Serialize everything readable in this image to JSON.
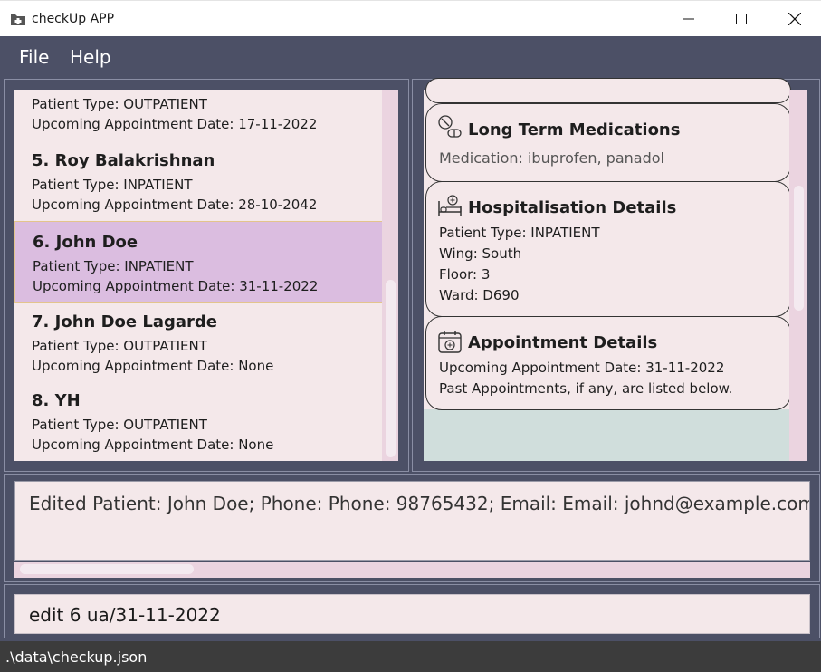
{
  "window": {
    "title": "checkUp APP",
    "icon": "medical-folder-icon"
  },
  "menu": [
    {
      "label": "File"
    },
    {
      "label": "Help"
    }
  ],
  "patient_list": [
    {
      "name": null,
      "type": "Patient Type: OUTPATIENT",
      "appt": "Upcoming Appointment Date: 17-11-2022"
    },
    {
      "name": "5.  Roy Balakrishnan",
      "type": "Patient Type: INPATIENT",
      "appt": "Upcoming Appointment Date: 28-10-2042"
    },
    {
      "name": "6.  John Doe",
      "type": "Patient Type: INPATIENT",
      "appt": "Upcoming Appointment Date: 31-11-2022",
      "selected": true
    },
    {
      "name": "7.  John Doe   Lagarde",
      "type": "Patient Type: OUTPATIENT",
      "appt": "Upcoming Appointment Date: None"
    },
    {
      "name": "8.  YH",
      "type": "Patient Type: OUTPATIENT",
      "appt": "Upcoming Appointment Date: None"
    }
  ],
  "details": {
    "medications": {
      "title": "Long Term Medications",
      "icon": "pill-icon",
      "line": "Medication: ibuprofen, panadol"
    },
    "hospitalisation": {
      "title": "Hospitalisation Details",
      "icon": "hospital-bed-icon",
      "lines": [
        "Patient Type: INPATIENT",
        "Wing: South",
        "Floor: 3",
        "Ward: D690"
      ]
    },
    "appointment": {
      "title": "Appointment Details",
      "icon": "calendar-icon",
      "lines": [
        "Upcoming Appointment Date: 31-11-2022",
        "Past Appointments, if any, are listed below."
      ]
    }
  },
  "result": {
    "text": "Edited Patient: John Doe; Phone: Phone: 98765432; Email: Email: johnd@example.com; Next of"
  },
  "command": {
    "value": "edit 6 ua/31-11-2022"
  },
  "status": {
    "path": ".\\data\\checkup.json"
  },
  "colors": {
    "background": "#4c5066",
    "card": "#f4e8ea",
    "selected": "#dbbde0",
    "selected_border": "#e3c48c"
  }
}
